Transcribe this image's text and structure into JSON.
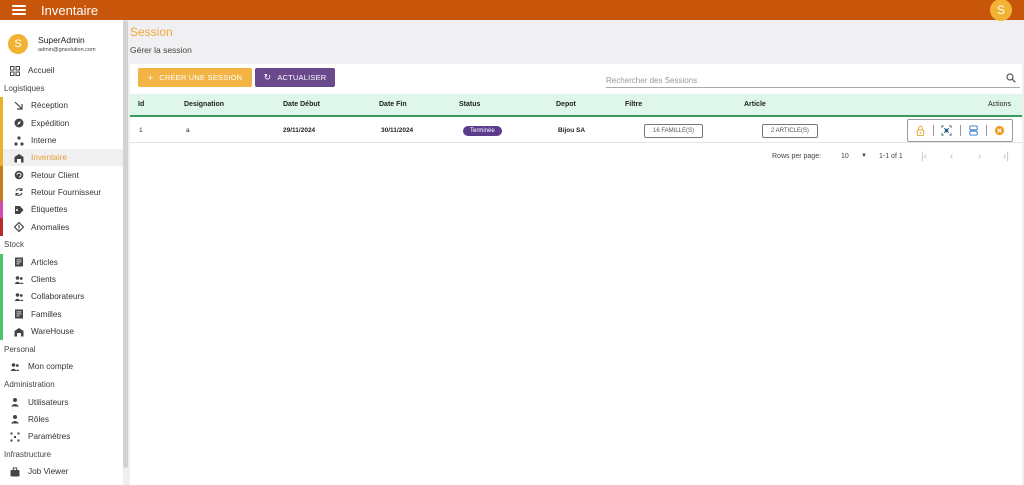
{
  "app": {
    "title": "Inventaire",
    "user_initial": "S"
  },
  "profile": {
    "initial": "S",
    "name": "SuperAdmin",
    "email": "admin@gnsolution.com"
  },
  "sidebar": {
    "home": "Accueil",
    "sections": {
      "logistiques": "Logistiques",
      "stock": "Stock",
      "personal": "Personal",
      "administration": "Administration",
      "infrastructure": "Infrastructure"
    },
    "logistiques_items": [
      {
        "label": "Réception",
        "icon": "arrow-down-right-icon",
        "bar": "#e9b22c"
      },
      {
        "label": "Expédition",
        "icon": "compass-icon",
        "bar": "#e9b22c"
      },
      {
        "label": "Interne",
        "icon": "hierarchy-icon",
        "bar": "#e9b22c"
      },
      {
        "label": "Inventaire",
        "icon": "warehouse-icon",
        "bar": "#e9b22c",
        "active": true
      },
      {
        "label": "Retour Client",
        "icon": "return-icon",
        "bar": "#c77d15"
      },
      {
        "label": "Retour Fournisseur",
        "icon": "sync-icon",
        "bar": "#c77d15"
      },
      {
        "label": "Étiquettes",
        "icon": "tag-icon",
        "bar": "#d14bb0"
      },
      {
        "label": "Anomalies",
        "icon": "warning-diamond-icon",
        "bar": "#b52a2a"
      }
    ],
    "stock_items": [
      {
        "label": "Articles",
        "icon": "document-icon",
        "bar": "#4cc46a"
      },
      {
        "label": "Clients",
        "icon": "people-icon",
        "bar": "#4cc46a"
      },
      {
        "label": "Collaborateurs",
        "icon": "people-icon",
        "bar": "#4cc46a"
      },
      {
        "label": "Familles",
        "icon": "document-icon",
        "bar": "#4cc46a"
      },
      {
        "label": "WareHouse",
        "icon": "warehouse-icon",
        "bar": "#4cc46a"
      }
    ],
    "personal_items": [
      {
        "label": "Mon compte",
        "icon": "people-icon"
      }
    ],
    "admin_items": [
      {
        "label": "Utilisateurs",
        "icon": "person-icon"
      },
      {
        "label": "Rôles",
        "icon": "person-icon"
      },
      {
        "label": "Paramètres",
        "icon": "settings-grid-icon"
      }
    ],
    "infra_items": [
      {
        "label": "Job Viewer",
        "icon": "briefcase-icon"
      }
    ]
  },
  "page": {
    "title": "Session",
    "subtitle": "Gérer la session"
  },
  "toolbar": {
    "create_label": "CRÉER UNE SESSION",
    "refresh_label": "ACTUALISER",
    "search_placeholder": "Rechercher des Sessions"
  },
  "table": {
    "headers": {
      "id": "Id",
      "designation": "Designation",
      "date_debut": "Date Début",
      "date_fin": "Date Fin",
      "status": "Status",
      "depot": "Depot",
      "filtre": "Filtre",
      "article": "Article",
      "actions": "Actions"
    },
    "rows": [
      {
        "id": "1",
        "designation": "a",
        "date_debut": "29/11/2024",
        "date_fin": "30/11/2024",
        "status": "Terminée",
        "depot": "Bijou SA",
        "filtre": "16 FAMILLE(S)",
        "article": "2 ARTICLE(S)"
      }
    ]
  },
  "pagination": {
    "rows_label": "Rows per page:",
    "rows_value": "10",
    "range": "1-1 of 1"
  },
  "colors": {
    "topbar": "#c8560a",
    "accent": "#f3b446",
    "purple": "#6a4a8c",
    "header_bg": "#dff6ea"
  }
}
